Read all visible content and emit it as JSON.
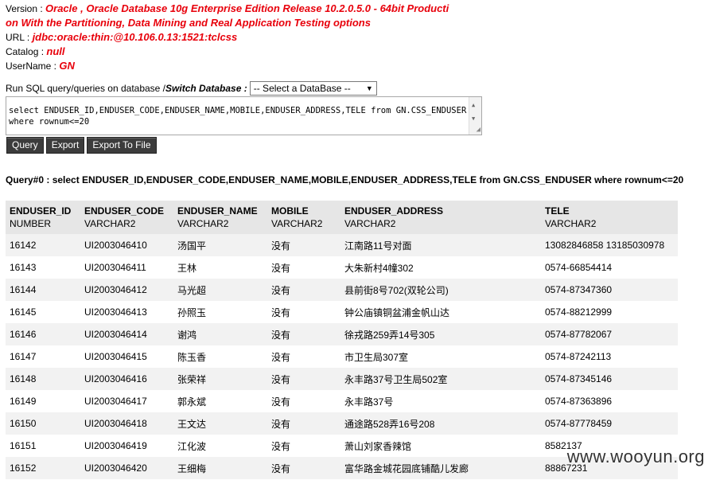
{
  "info": {
    "version_label": "Version : ",
    "version_line1": "Oracle , Oracle Database 10g Enterprise Edition Release 10.2.0.5.0 - 64bit Producti",
    "version_line2": "on With the Partitioning, Data Mining and Real Application Testing options",
    "url_label": "URL : ",
    "url_value": "jdbc:oracle:thin:@10.106.0.13:1521:tclcss",
    "catalog_label": "Catalog : ",
    "catalog_value": "null",
    "username_label": "UserName : ",
    "username_value": "GN"
  },
  "sql": {
    "prompt": "Run SQL query/queries on database / ",
    "switch_label": "Switch Database :",
    "select_value": "-- Select a DataBase --",
    "query_text": "select ENDUSER_ID,ENDUSER_CODE,ENDUSER_NAME,MOBILE,ENDUSER_ADDRESS,TELE from GN.CSS_ENDUSER where rownum<=20"
  },
  "buttons": {
    "query": "Query",
    "export": "Export",
    "export_file": "Export To File"
  },
  "result": {
    "title": "Query#0 : select ENDUSER_ID,ENDUSER_CODE,ENDUSER_NAME,MOBILE,ENDUSER_ADDRESS,TELE from GN.CSS_ENDUSER where rownum<=20",
    "columns": [
      {
        "name": "ENDUSER_ID",
        "type": "NUMBER"
      },
      {
        "name": "ENDUSER_CODE",
        "type": "VARCHAR2"
      },
      {
        "name": "ENDUSER_NAME",
        "type": "VARCHAR2"
      },
      {
        "name": "MOBILE",
        "type": "VARCHAR2"
      },
      {
        "name": "ENDUSER_ADDRESS",
        "type": "VARCHAR2"
      },
      {
        "name": "TELE",
        "type": "VARCHAR2"
      }
    ],
    "rows": [
      [
        "16142",
        "UI2003046410",
        "汤国平",
        "没有",
        "江南路11号对面",
        "13082846858 13185030978"
      ],
      [
        "16143",
        "UI2003046411",
        "王林",
        "没有",
        "大朱新村4幢302",
        "0574-66854414"
      ],
      [
        "16144",
        "UI2003046412",
        "马光超",
        "没有",
        "县前街8号702(双轮公司)",
        "0574-87347360"
      ],
      [
        "16145",
        "UI2003046413",
        "孙照玉",
        "没有",
        "钟公庙镇铜盆浦金帆山达",
        "0574-88212999"
      ],
      [
        "16146",
        "UI2003046414",
        "谢鸿",
        "没有",
        "徐戎路259弄14号305",
        "0574-87782067"
      ],
      [
        "16147",
        "UI2003046415",
        "陈玉香",
        "没有",
        "市卫生局307室",
        "0574-87242113"
      ],
      [
        "16148",
        "UI2003046416",
        "张荣祥",
        "没有",
        "永丰路37号卫生局502室",
        "0574-87345146"
      ],
      [
        "16149",
        "UI2003046417",
        "郭永斌",
        "没有",
        "永丰路37号",
        "0574-87363896"
      ],
      [
        "16150",
        "UI2003046418",
        "王文达",
        "没有",
        "通途路528弄16号208",
        "0574-87778459"
      ],
      [
        "16151",
        "UI2003046419",
        "江化波",
        "没有",
        "萧山刘家香辣馆",
        "8582137"
      ],
      [
        "16152",
        "UI2003046420",
        "王细梅",
        "没有",
        "富华路金城花园底铺酷儿发廊",
        "88867231"
      ]
    ]
  },
  "watermark": "www.wooyun.org"
}
